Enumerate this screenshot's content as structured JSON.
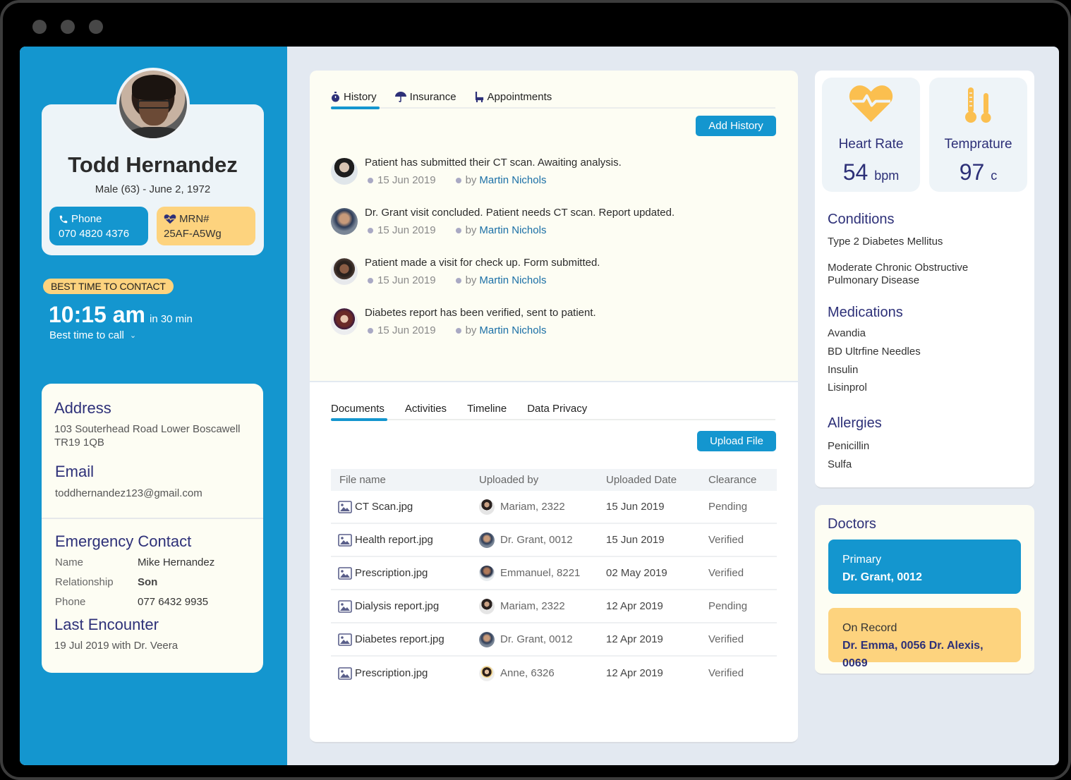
{
  "patient": {
    "name": "Todd Hernandez",
    "subtitle": "Male (63) - June 2, 1972",
    "phone_label": "Phone",
    "phone": "070 4820 4376",
    "mrn_label": "MRN#",
    "mrn": "25AF-A5Wg"
  },
  "contact_time": {
    "badge": "BEST TIME TO CONTACT",
    "time": "10:15 am",
    "relative": "in 30 min",
    "dropdown_label": "Best time to call"
  },
  "details": {
    "address_title": "Address",
    "address_line1": "103  Souterhead Road Lower Boscawell",
    "address_line2": "TR19 1QB",
    "email_title": "Email",
    "email": "toddhernandez123@gmail.com",
    "emergency_title": "Emergency Contact",
    "emergency": [
      {
        "key": "Name",
        "value": "Mike Hernandez"
      },
      {
        "key": "Relationship",
        "value": "Son"
      },
      {
        "key": "Phone",
        "value": "077 6432 9935"
      }
    ],
    "last_encounter_title": "Last Encounter",
    "last_encounter": "19 Jul 2019 with Dr. Veera"
  },
  "history_panel": {
    "tabs": [
      {
        "label": "History",
        "icon": "stopwatch-icon",
        "active": true
      },
      {
        "label": "Insurance",
        "icon": "umbrella-icon",
        "active": false
      },
      {
        "label": "Appointments",
        "icon": "chair-icon",
        "active": false
      }
    ],
    "add_button": "Add History",
    "items": [
      {
        "text": "Patient has submitted their CT scan. Awaiting analysis.",
        "date": "15 Jun 2019",
        "by": "by",
        "author": "Martin Nichols"
      },
      {
        "text": "Dr. Grant visit concluded. Patient needs CT scan. Report updated.",
        "date": "15 Jun 2019",
        "by": "by",
        "author": "Martin Nichols"
      },
      {
        "text": "Patient made a visit for check up. Form submitted.",
        "date": "15 Jun 2019",
        "by": "by",
        "author": "Martin Nichols"
      },
      {
        "text": "Diabetes report has been verified, sent to patient.",
        "date": "15 Jun 2019",
        "by": "by",
        "author": "Martin Nichols"
      }
    ]
  },
  "documents_panel": {
    "tabs": [
      {
        "label": "Documents",
        "active": true
      },
      {
        "label": "Activities",
        "active": false
      },
      {
        "label": "Timeline",
        "active": false
      },
      {
        "label": "Data Privacy",
        "active": false
      }
    ],
    "upload_button": "Upload  File",
    "columns": [
      "File name",
      "Uploaded by",
      "Uploaded Date",
      "Clearance"
    ],
    "rows": [
      {
        "file": "CT Scan.jpg",
        "uploader": "Mariam, 2322",
        "date": "15 Jun 2019",
        "clearance": "Pending"
      },
      {
        "file": "Health report.jpg",
        "uploader": "Dr. Grant, 0012",
        "date": "15 Jun 2019",
        "clearance": "Verified"
      },
      {
        "file": "Prescription.jpg",
        "uploader": "Emmanuel, 8221",
        "date": "02 May 2019",
        "clearance": "Verified"
      },
      {
        "file": "Dialysis report.jpg",
        "uploader": "Mariam, 2322",
        "date": "12 Apr 2019",
        "clearance": "Pending"
      },
      {
        "file": "Diabetes report.jpg",
        "uploader": "Dr. Grant, 0012",
        "date": "12 Apr 2019",
        "clearance": "Verified"
      },
      {
        "file": "Prescription.jpg",
        "uploader": "Anne, 6326",
        "date": "12 Apr 2019",
        "clearance": "Verified"
      }
    ]
  },
  "vitals": {
    "heart_rate_label": "Heart Rate",
    "heart_rate_value": "54",
    "heart_rate_unit": "bpm",
    "temperature_label": "Temprature",
    "temperature_value": "97",
    "temperature_unit": "c"
  },
  "clinical": {
    "conditions_title": "Conditions",
    "conditions": [
      "Type 2 Diabetes Mellitus",
      "Moderate Chronic Obstructive Pulmonary Disease"
    ],
    "medications_title": "Medications",
    "medications": [
      "Avandia",
      "BD Ultrfine Needles",
      "Insulin",
      "Lisinprol"
    ],
    "allergies_title": "Allergies",
    "allergies": [
      "Penicillin",
      "Sulfa"
    ]
  },
  "doctors": {
    "title": "Doctors",
    "primary_label": "Primary",
    "primary": "Dr. Grant, 0012",
    "record_label": "On Record",
    "record": "Dr. Emma, 0056 Dr. Alexis, 0069"
  },
  "colors": {
    "primary_blue": "#1496cf",
    "accent_yellow": "#fdd37e",
    "heading_navy": "#2d3078",
    "vital_icon_orange": "#fbbf4f"
  }
}
